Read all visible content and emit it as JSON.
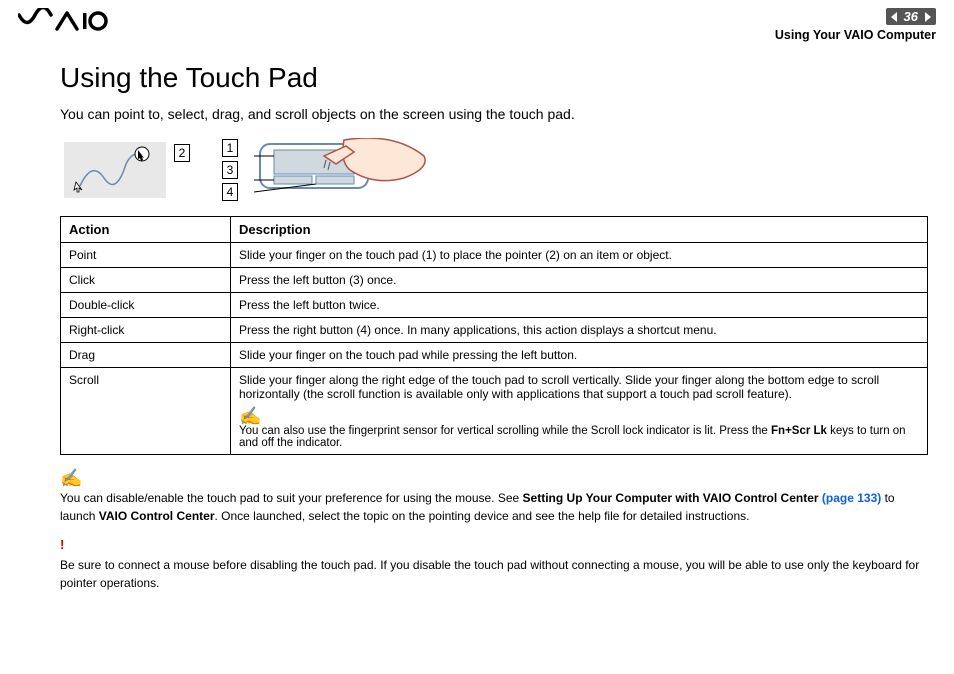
{
  "header": {
    "page_number": "36",
    "chapter": "Using Your VAIO Computer"
  },
  "title": "Using the Touch Pad",
  "intro": "You can point to, select, drag, and scroll objects on the screen using the touch pad.",
  "callouts": {
    "c1": "1",
    "c2": "2",
    "c3": "3",
    "c4": "4"
  },
  "table": {
    "headers": {
      "action": "Action",
      "description": "Description"
    },
    "rows": [
      {
        "action": "Point",
        "description": "Slide your finger on the touch pad (1) to place the pointer (2) on an item or object."
      },
      {
        "action": "Click",
        "description": "Press the left button (3) once."
      },
      {
        "action": "Double-click",
        "description": "Press the left button twice."
      },
      {
        "action": "Right-click",
        "description": "Press the right button (4) once. In many applications, this action displays a shortcut menu."
      },
      {
        "action": "Drag",
        "description": "Slide your finger on the touch pad while pressing the left button."
      }
    ],
    "scroll": {
      "action": "Scroll",
      "description": "Slide your finger along the right edge of the touch pad to scroll vertically. Slide your finger along the bottom edge to scroll horizontally (the scroll function is available only with applications that support a touch pad scroll feature).",
      "note_pre": "You can also use the fingerprint sensor for vertical scrolling while the Scroll lock indicator is lit. Press the ",
      "note_bold": "Fn+Scr Lk",
      "note_post": " keys to turn on and off the indicator."
    }
  },
  "footnote1": {
    "pre": "You can disable/enable the touch pad to suit your preference for using the mouse. See ",
    "bold1": "Setting Up Your Computer with VAIO Control Center",
    "link": " (page 133)",
    "mid": " to launch ",
    "bold2": "VAIO Control Center",
    "post": ". Once launched, select the topic on the pointing device and see the help file for detailed instructions."
  },
  "footnote2": {
    "warn": "!",
    "text": "Be sure to connect a mouse before disabling the touch pad. If you disable the touch pad without connecting a mouse, you will be able to use only the keyboard for pointer operations."
  }
}
